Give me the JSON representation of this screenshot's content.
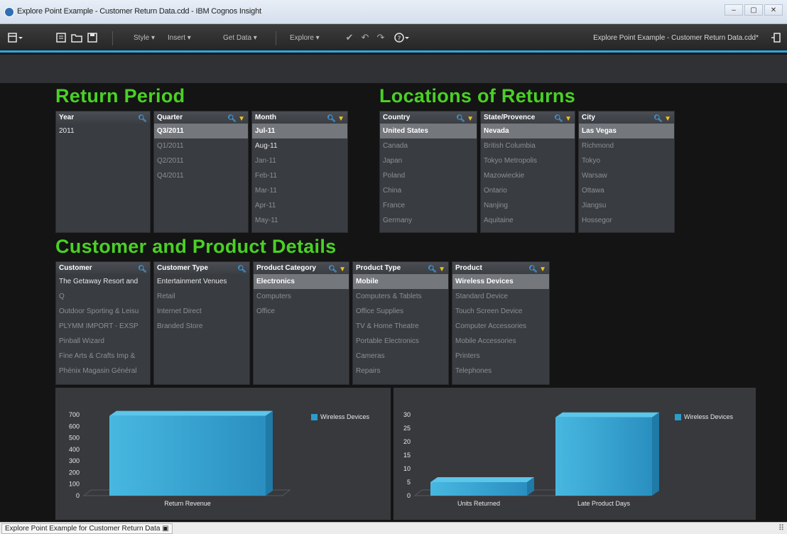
{
  "window": {
    "title": "Explore Point Example - Customer Return Data.cdd - IBM Cognos Insight",
    "controls": [
      "–",
      "▢",
      "✕"
    ]
  },
  "toolbar": {
    "menus": [
      "Style ▾",
      "Insert ▾",
      "Get Data ▾",
      "Explore ▾"
    ],
    "doc_title": "Explore Point Example - Customer Return Data.cdd*"
  },
  "sections": {
    "return_period": "Return Period",
    "locations": "Locations of Returns",
    "customer_product": "Customer and Product Details"
  },
  "lists": {
    "year": {
      "header": "Year",
      "items": [
        "2011"
      ]
    },
    "quarter": {
      "header": "Quarter",
      "items": [
        "Q3/2011",
        "Q1/2011",
        "Q2/2011",
        "Q4/2011"
      ]
    },
    "month": {
      "header": "Month",
      "items": [
        "Jul-11",
        "Aug-11",
        "Jan-11",
        "Feb-11",
        "Mar-11",
        "Apr-11",
        "May-11"
      ]
    },
    "country": {
      "header": "Country",
      "items": [
        "United States",
        "Canada",
        "Japan",
        "Poland",
        "China",
        "France",
        "Germany"
      ]
    },
    "state": {
      "header": "State/Provence",
      "items": [
        "Nevada",
        "British Columbia",
        "Tokyo Metropolis",
        "Mazowieckie",
        "Ontario",
        "Nanjing",
        "Aquitaine"
      ]
    },
    "city": {
      "header": "City",
      "items": [
        "Las Vegas",
        "Richmond",
        "Tokyo",
        "Warsaw",
        "Ottawa",
        "Jiangsu",
        "Hossegor"
      ]
    },
    "customer": {
      "header": "Customer",
      "items": [
        "The Getaway Resort and",
        "Q",
        "Outdoor Sporting & Leisu",
        "PLYMM IMPORT - EXSP",
        "Pinball Wizard",
        "Fine Arts & Crafts Imp &",
        "Phénix Magasin Général"
      ]
    },
    "customer_type": {
      "header": "Customer Type",
      "items": [
        "Entertainment Venues",
        "Retail",
        "Internet Direct",
        "Branded Store"
      ]
    },
    "product_category": {
      "header": "Product Category",
      "items": [
        "Electronics",
        "Computers",
        "Office"
      ]
    },
    "product_type": {
      "header": "Product Type",
      "items": [
        "Mobile",
        "Computers & Tablets",
        "Office Supplies",
        "TV & Home Theatre",
        "Portable Electronics",
        "Cameras",
        "Repairs"
      ]
    },
    "product": {
      "header": "Product",
      "items": [
        "Wireless Devices",
        "Standard Device",
        "Touch Screen Device",
        "Computer Accessories",
        "Mobile Accessories",
        "Printers",
        "Telephones"
      ]
    }
  },
  "chart_data": [
    {
      "type": "bar",
      "categories": [
        "Return Revenue"
      ],
      "series": [
        {
          "name": "Wireless Devices",
          "values": [
            690
          ]
        }
      ],
      "ylim": [
        0,
        700
      ],
      "yticks": [
        0,
        100,
        200,
        300,
        400,
        500,
        600,
        700
      ],
      "legend": "top-right",
      "color": "#2b9ccc"
    },
    {
      "type": "bar",
      "categories": [
        "Units Returned",
        "Late Product Days"
      ],
      "series": [
        {
          "name": "Wireless Devices",
          "values": [
            5,
            29
          ]
        }
      ],
      "ylim": [
        0,
        30
      ],
      "yticks": [
        0,
        5,
        10,
        15,
        20,
        25,
        30
      ],
      "legend": "top-right",
      "color": "#2b9ccc"
    }
  ],
  "statusbar": {
    "tab": "Explore Point Example for Customer Return Data"
  }
}
